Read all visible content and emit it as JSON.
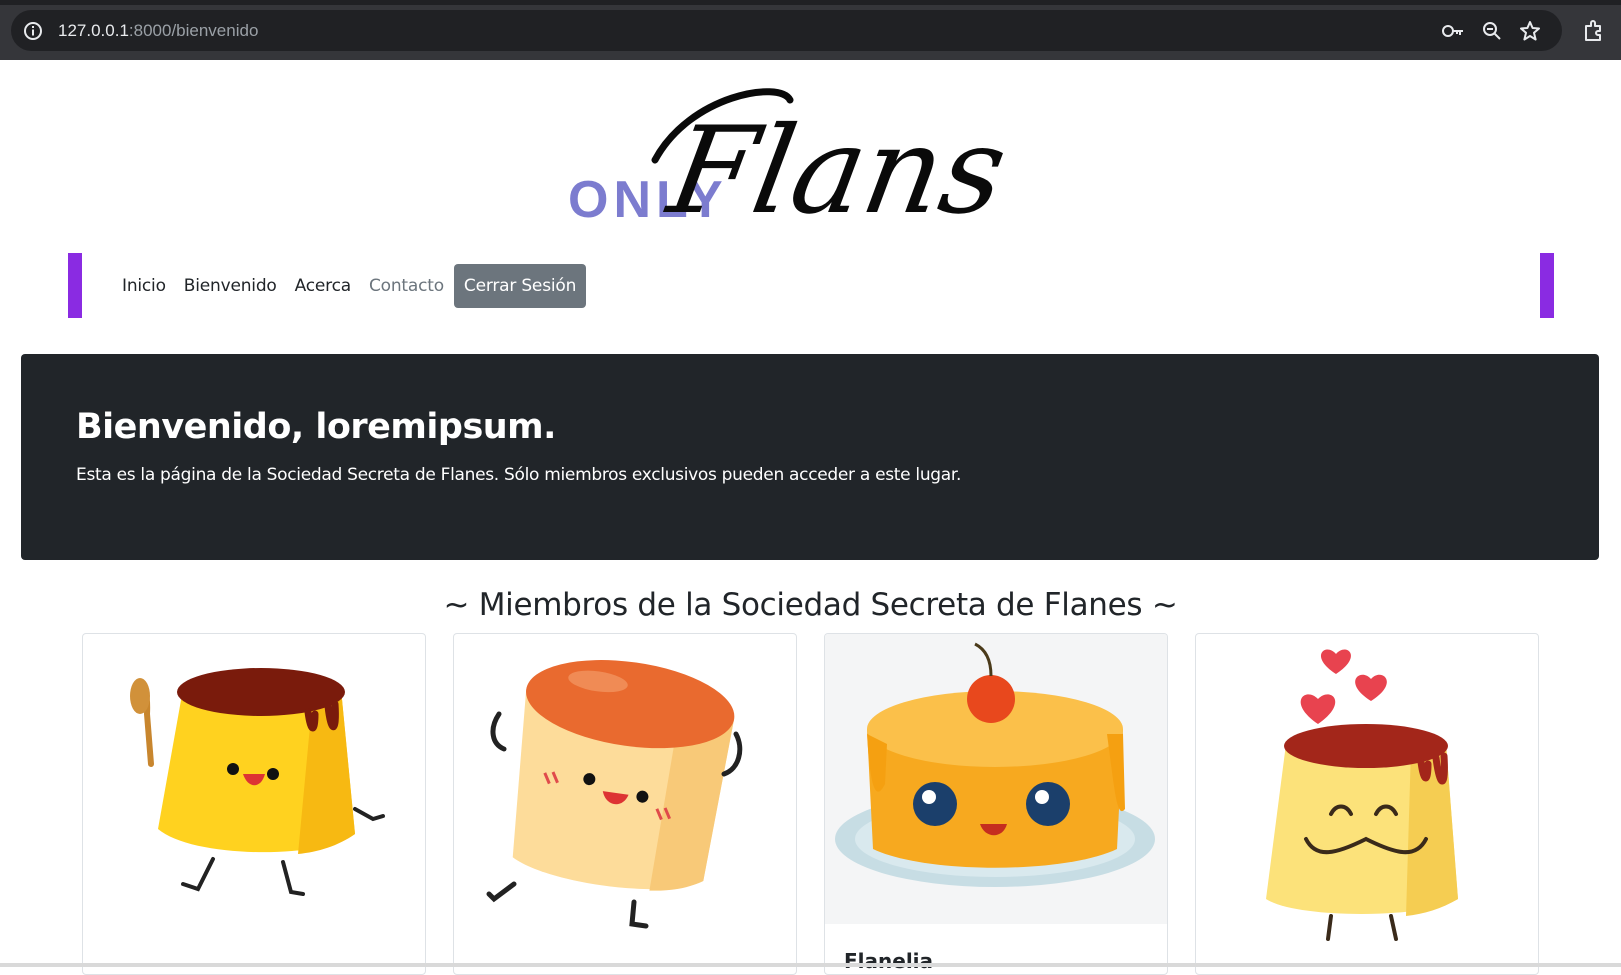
{
  "browser": {
    "url_host": "127.0.0.1",
    "url_path": ":8000/bienvenido",
    "icons": [
      "info-icon",
      "key-icon",
      "zoom-icon",
      "star-icon",
      "extensions-icon"
    ]
  },
  "logo": {
    "text": "ONLY Flans",
    "only_color": "#7c7ccf"
  },
  "nav": {
    "items": [
      {
        "label": "Inicio"
      },
      {
        "label": "Bienvenido"
      },
      {
        "label": "Acerca"
      },
      {
        "label": "Contacto"
      }
    ],
    "logout_label": "Cerrar Sesión",
    "accent_color": "#8a2be2"
  },
  "hero": {
    "title": "Bienvenido, loremipsum.",
    "text": "Esta es la página de la Sociedad Secreta de Flanes. Sólo miembros exclusivos pueden acceder a este lugar."
  },
  "members": {
    "title": "~ Miembros de la Sociedad Secreta de Flanes ~",
    "cards": [
      {
        "name": ""
      },
      {
        "name": ""
      },
      {
        "name": "Flanelia"
      },
      {
        "name": ""
      }
    ]
  }
}
